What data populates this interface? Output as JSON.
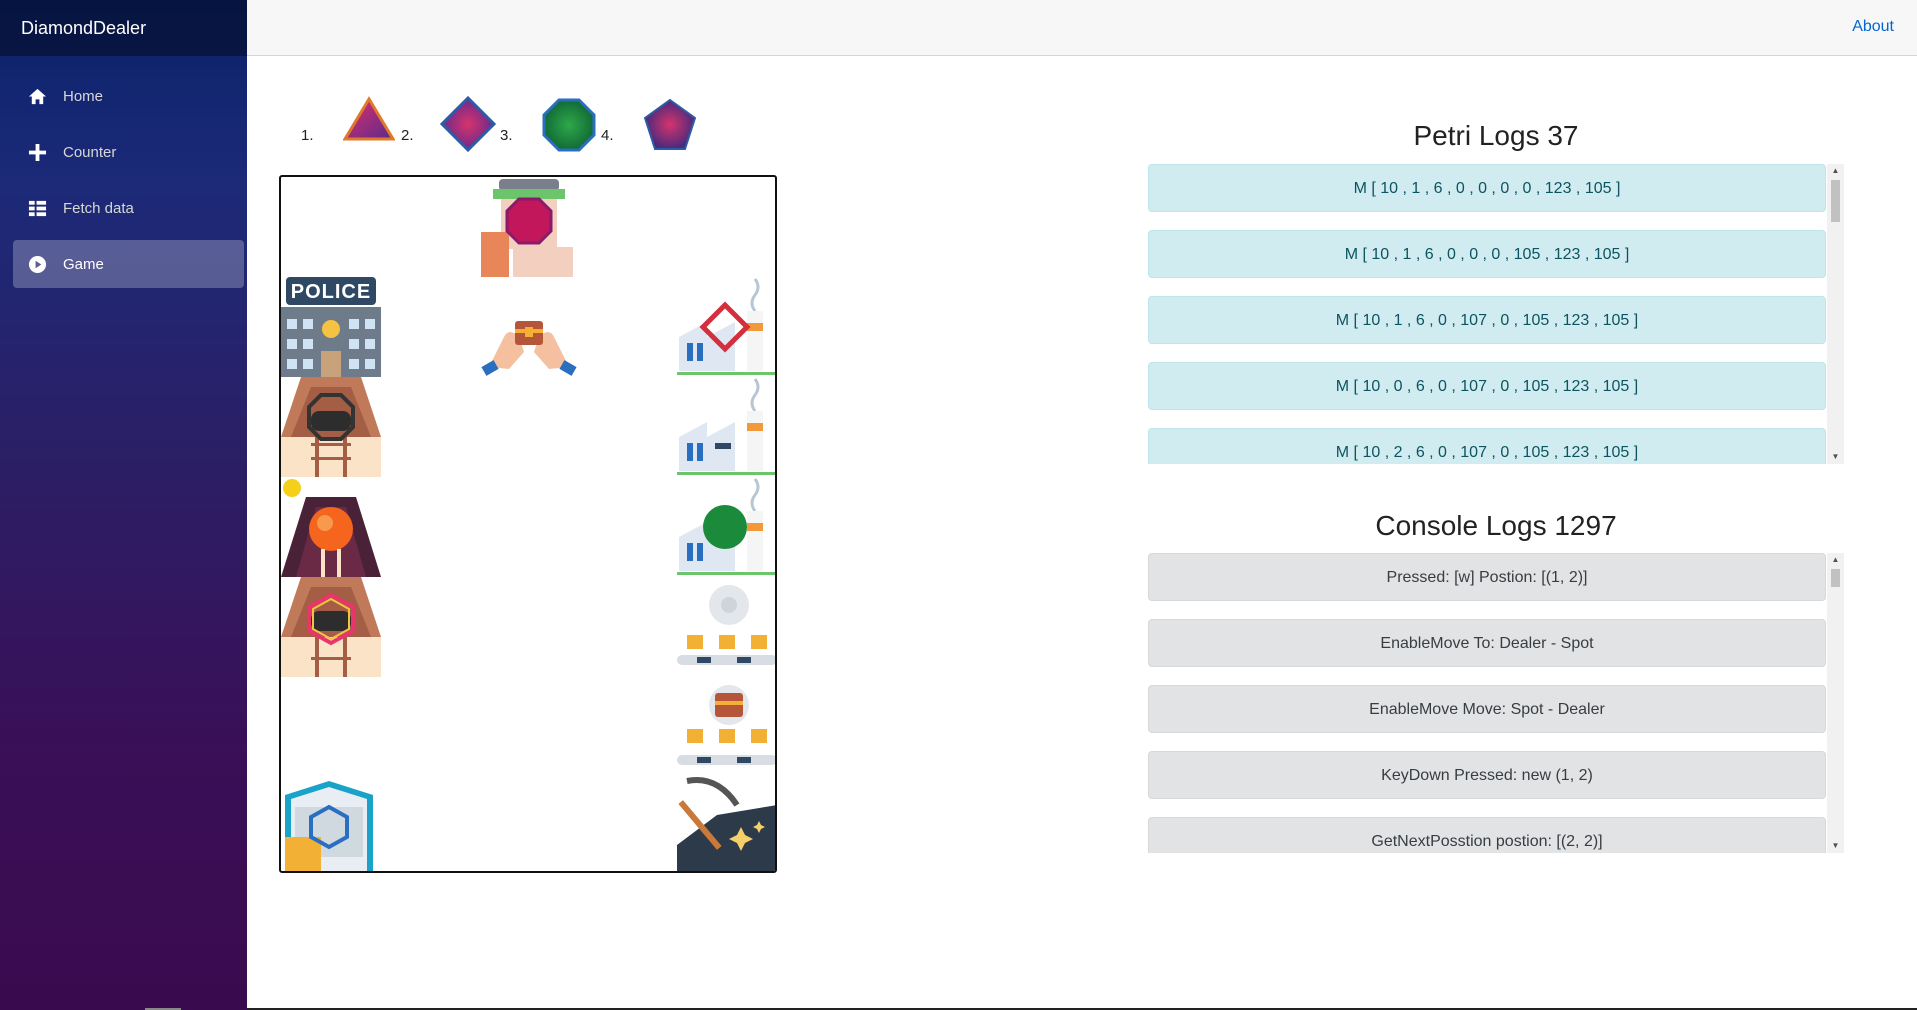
{
  "app": {
    "brand": "DiamondDealer"
  },
  "sidebar": {
    "items": [
      {
        "label": "Home",
        "icon": "home-icon",
        "active": false
      },
      {
        "label": "Counter",
        "icon": "plus-icon",
        "active": false
      },
      {
        "label": "Fetch data",
        "icon": "list-icon",
        "active": false
      },
      {
        "label": "Game",
        "icon": "play-icon",
        "active": true
      }
    ]
  },
  "topbar": {
    "about_label": "About"
  },
  "legend": {
    "items": [
      {
        "number": "1.",
        "shape": "triangle"
      },
      {
        "number": "2.",
        "shape": "diamond"
      },
      {
        "number": "3.",
        "shape": "octagon"
      },
      {
        "number": "4.",
        "shape": "pentagon"
      }
    ]
  },
  "board": {
    "police_label": "POLICE"
  },
  "petri": {
    "title": "Petri Logs 37",
    "entries": [
      "M [ 10 , 1 , 6 , 0 , 0 , 0 , 0 , 123 , 105 ]",
      "M [ 10 , 1 , 6 , 0 , 0 , 0 , 105 , 123 , 105 ]",
      "M [ 10 , 1 , 6 , 0 , 107 , 0 , 105 , 123 , 105 ]",
      "M [ 10 , 0 , 6 , 0 , 107 , 0 , 105 , 123 , 105 ]",
      "M [ 10 , 2 , 6 , 0 , 107 , 0 , 105 , 123 , 105 ]"
    ]
  },
  "console": {
    "title": "Console Logs 1297",
    "entries": [
      "Pressed: [w] Postion: [(1, 2)]",
      "EnableMove To: Dealer - Spot",
      "EnableMove Move: Spot - Dealer",
      "KeyDown Pressed: new (1, 2)",
      "GetNextPosstion postion: [(2, 2)]"
    ]
  },
  "colors": {
    "accent_link": "#0366d6",
    "petri_bg": "#d1ecf1",
    "console_bg": "#e2e3e5",
    "gem_pink": "#c2185b",
    "gem_green": "#1b8a3a"
  }
}
